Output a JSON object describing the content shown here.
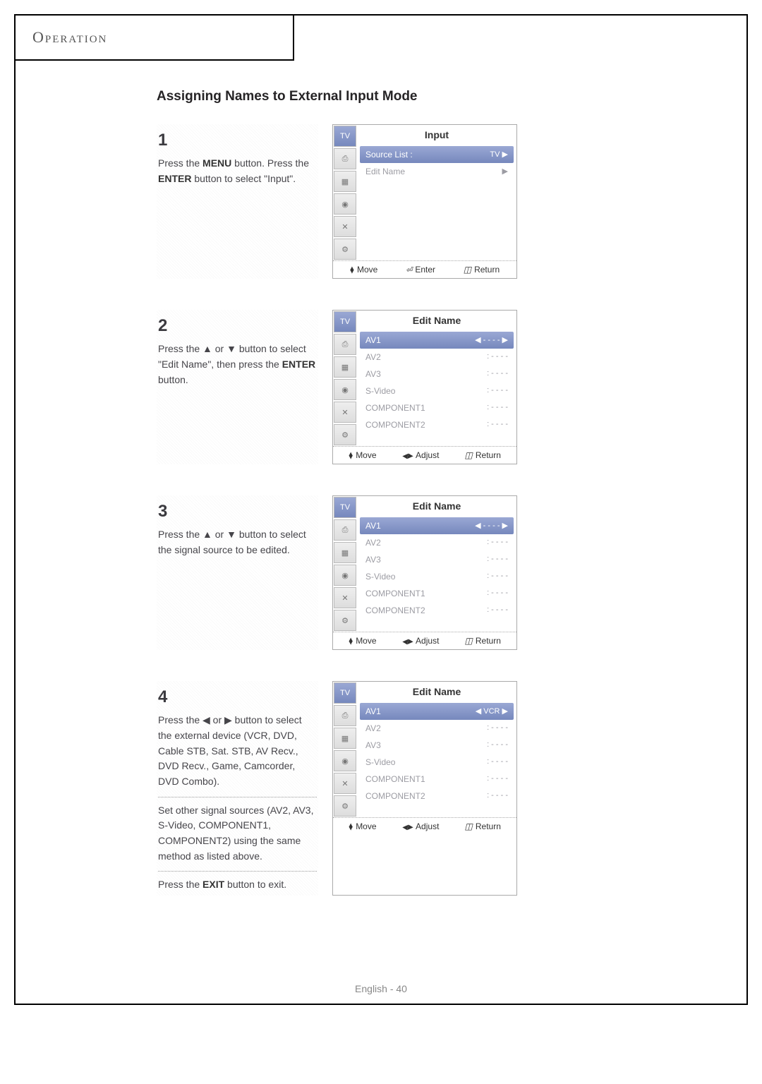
{
  "header": "Operation",
  "title": "Assigning Names to External Input Mode",
  "footer": "English - 40",
  "steps": [
    {
      "num": "1",
      "text_parts": [
        "Press the ",
        "MENU",
        " button. Press the ",
        "ENTER",
        " button to select \"Input\"."
      ],
      "osd": {
        "title": "Input",
        "items": [
          {
            "label": "Source List :",
            "value": "TV",
            "sel": true,
            "arrow": "▶"
          },
          {
            "label": "Edit Name",
            "value": "",
            "sel": false,
            "arrow": "▶"
          }
        ],
        "foot": [
          "Move",
          "Enter",
          "Return"
        ],
        "foot_mode": "enter"
      }
    },
    {
      "num": "2",
      "text_parts": [
        "Press the ▲ or ▼ button to select \"Edit Name\", then press the ",
        "ENTER",
        " button."
      ],
      "osd": {
        "title": "Edit Name",
        "items": [
          {
            "label": "AV1",
            "value": "◀ - - - - ▶",
            "sel": true
          },
          {
            "label": "AV2",
            "value": ": - - - -",
            "sel": false
          },
          {
            "label": "AV3",
            "value": ": - - - -",
            "sel": false
          },
          {
            "label": "S-Video",
            "value": ": - - - -",
            "sel": false
          },
          {
            "label": "COMPONENT1",
            "value": ": - - - -",
            "sel": false
          },
          {
            "label": "COMPONENT2",
            "value": ": - - - -",
            "sel": false
          }
        ],
        "foot": [
          "Move",
          "Adjust",
          "Return"
        ],
        "foot_mode": "adjust"
      }
    },
    {
      "num": "3",
      "text_parts": [
        "Press the ▲ or ▼ button to select the signal source to be edited."
      ],
      "osd": {
        "title": "Edit Name",
        "items": [
          {
            "label": "AV1",
            "value": "◀ - - - - ▶",
            "sel": true
          },
          {
            "label": "AV2",
            "value": ": - - - -",
            "sel": false
          },
          {
            "label": "AV3",
            "value": ": - - - -",
            "sel": false
          },
          {
            "label": "S-Video",
            "value": ": - - - -",
            "sel": false
          },
          {
            "label": "COMPONENT1",
            "value": ": - - - -",
            "sel": false
          },
          {
            "label": "COMPONENT2",
            "value": ": - - - -",
            "sel": false
          }
        ],
        "foot": [
          "Move",
          "Adjust",
          "Return"
        ],
        "foot_mode": "adjust"
      }
    },
    {
      "num": "4",
      "text_parts": [
        "Press the ◀ or ▶ button to select the external device (VCR, DVD, Cable STB, Sat. STB, AV Recv., DVD Recv., Game, Camcorder, DVD Combo)."
      ],
      "text_extra1": "Set other signal sources (AV2, AV3, S-Video, COMPONENT1, COMPONENT2) using the same method as listed above.",
      "text_extra2_parts": [
        "Press the ",
        "EXIT",
        " button to exit."
      ],
      "osd": {
        "title": "Edit Name",
        "items": [
          {
            "label": "AV1",
            "value": "◀ VCR ▶",
            "sel": true
          },
          {
            "label": "AV2",
            "value": ": - - - -",
            "sel": false
          },
          {
            "label": "AV3",
            "value": ": - - - -",
            "sel": false
          },
          {
            "label": "S-Video",
            "value": ": - - - -",
            "sel": false
          },
          {
            "label": "COMPONENT1",
            "value": ": - - - -",
            "sel": false
          },
          {
            "label": "COMPONENT2",
            "value": ": - - - -",
            "sel": false
          }
        ],
        "foot": [
          "Move",
          "Adjust",
          "Return"
        ],
        "foot_mode": "adjust"
      }
    }
  ],
  "osd_icons": [
    "TV",
    "⎙",
    "▦",
    "◉",
    "✕",
    "⚙"
  ]
}
